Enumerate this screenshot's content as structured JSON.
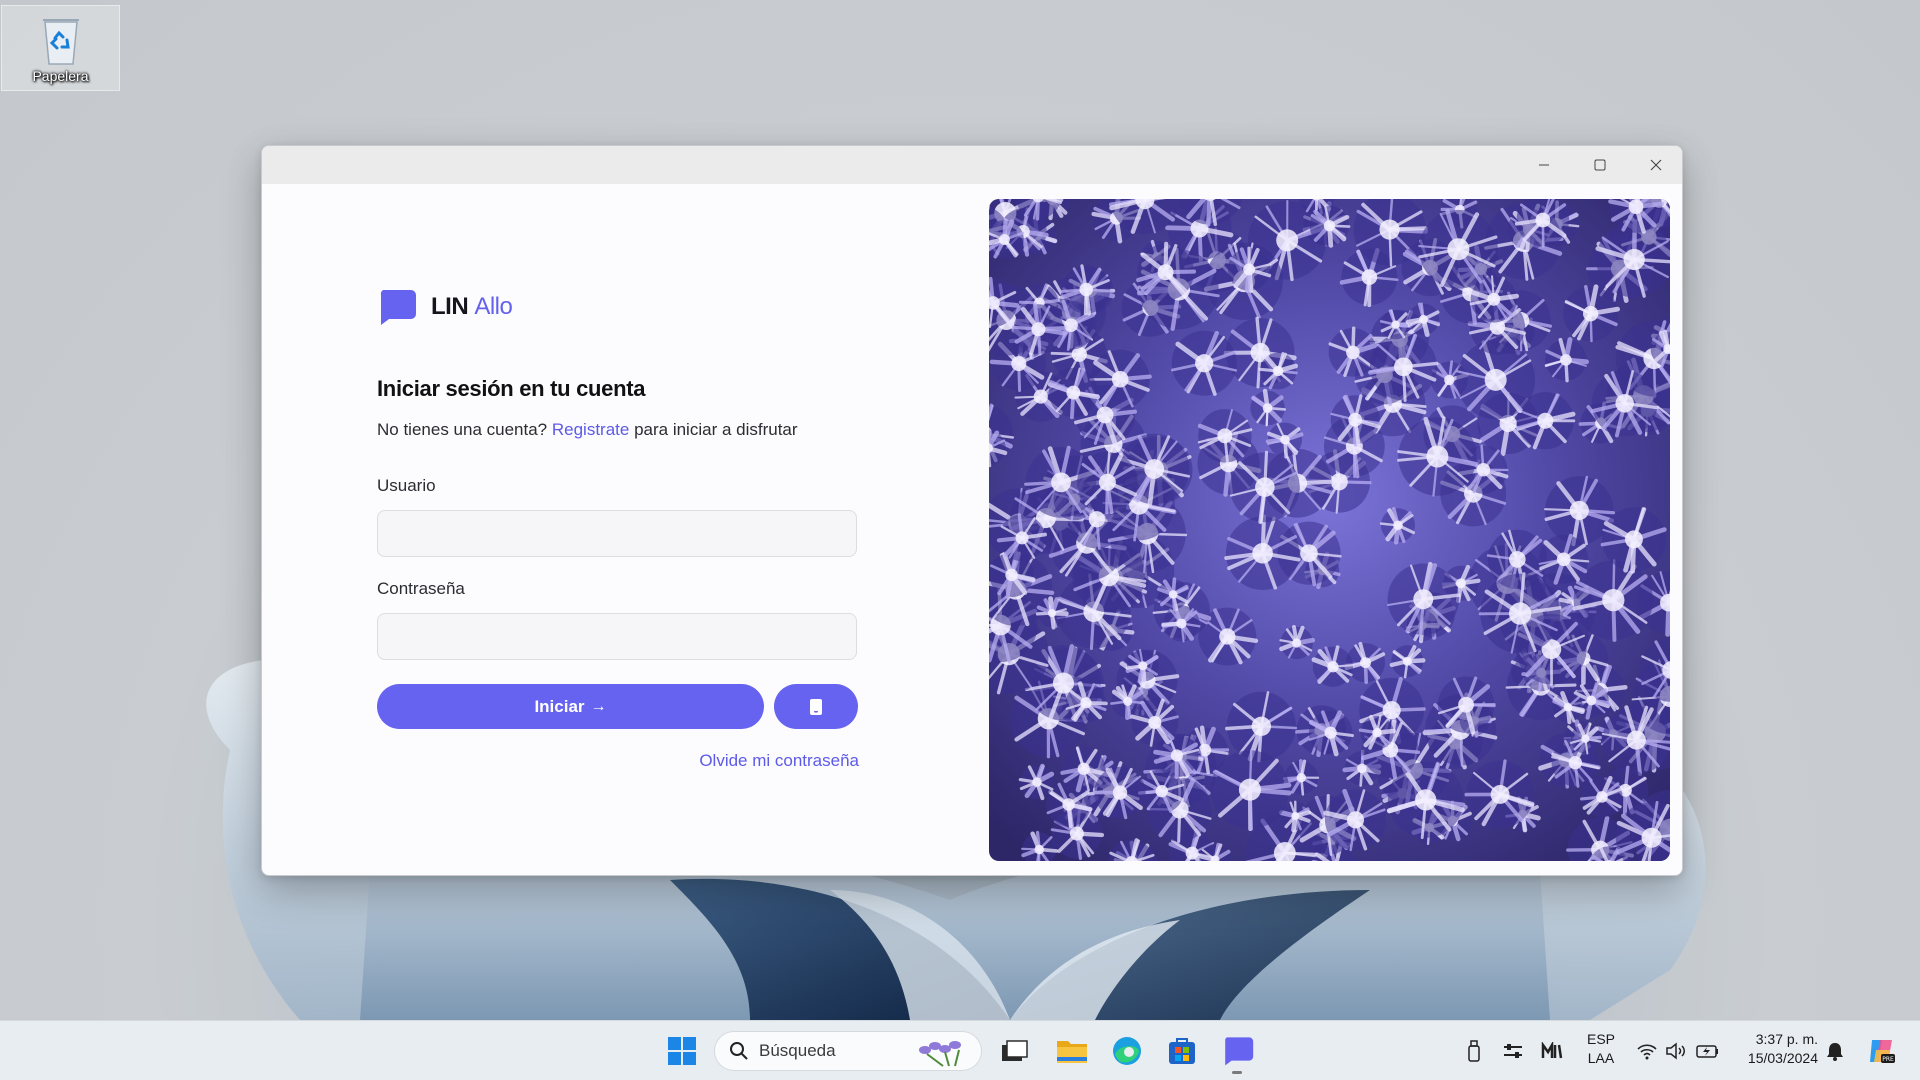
{
  "desktop": {
    "icons": [
      {
        "label": "Papelera",
        "icon": "recycle-bin-icon"
      }
    ]
  },
  "window": {
    "controls": {
      "minimize": "minimize-icon",
      "maximize": "maximize-icon",
      "close": "close-icon"
    },
    "logo": {
      "word1": "LIN",
      "word2": "Allo",
      "icon": "chat-bubble-icon"
    },
    "heading": "Iniciar sesión en tu cuenta",
    "subline": {
      "before": "No tienes una cuenta?",
      "link": "Registrate",
      "after": "para iniciar a disfrutar"
    },
    "username": {
      "label": "Usuario",
      "value": "",
      "placeholder": ""
    },
    "password": {
      "label": "Contraseña",
      "value": "",
      "placeholder": ""
    },
    "login_button": {
      "label": "Iniciar",
      "arrow": "→"
    },
    "device_button": {
      "icon": "smartphone-icon"
    },
    "forgot_link": "Olvide mi contraseña",
    "accent_color": "#6663f0",
    "side_image": "snowy-forest-aerial-photo"
  },
  "taskbar": {
    "search_placeholder": "Búsqueda",
    "apps": [
      "windows-start-icon",
      "task-view-icon",
      "file-explorer-icon",
      "edge-icon",
      "store-icon",
      "lin-allo-app-icon"
    ],
    "tray": {
      "language_line1": "ESP",
      "language_line2": "LAA",
      "time": "3:37 p. m.",
      "date": "15/03/2024"
    }
  }
}
